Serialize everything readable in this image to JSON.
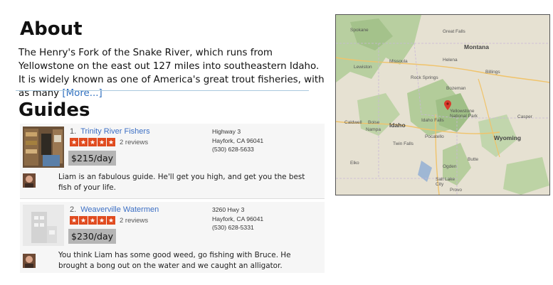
{
  "about": {
    "title": "About",
    "text": "The Henry's Fork of the Snake River, which runs from Yellowstone on the east out 127 miles into southeastern Idaho. It is widely known as one of America's great trout fisheries, with as many ",
    "more_link": "[More...]"
  },
  "guides": {
    "title": "Guides",
    "items": [
      {
        "number": "1.",
        "name": "Trinity River Fishers",
        "rating": 5,
        "reviews": "2 reviews",
        "price": "$215/day",
        "address": [
          "Highway 3",
          "Hayfork, CA 96041",
          "(530) 628-5633"
        ],
        "comment": "Liam is an fabulous guide. He'll get you high, and get you the best fish of your life."
      },
      {
        "number": "2.",
        "name": "Weaverville Watermen",
        "rating": 5,
        "reviews": "2 reviews",
        "price": "$230/day",
        "address": [
          "3260 Hwy 3",
          "Hayfork, CA 96041",
          "(530) 628-5331"
        ],
        "comment": "You think Liam has some good weed, go fishing with Bruce. He brought a bong out on the water and we caught an alligator."
      }
    ]
  },
  "map": {
    "labels": [
      "Montana",
      "Idaho",
      "Wyoming",
      "Yellowstone National Park",
      "Salt Lake City",
      "Billings",
      "Great Falls",
      "Boise",
      "Helena",
      "Bozeman",
      "Missoula",
      "Pocatello",
      "Idaho Falls",
      "Twin Falls",
      "Spokane",
      "Casper",
      "Caldwell",
      "Nampa",
      "Rock Springs",
      "Butte",
      "Lewiston",
      "Ogden",
      "Provo",
      "Elko"
    ],
    "marker_color": "#d93a2b"
  }
}
